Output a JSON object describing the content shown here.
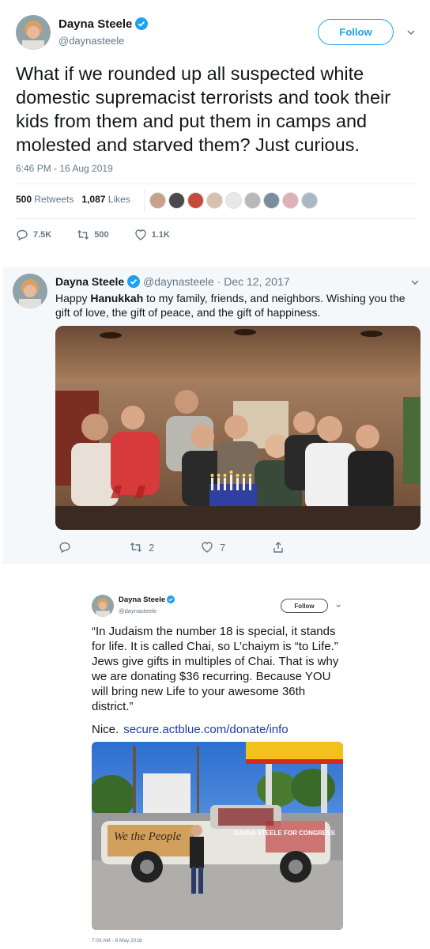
{
  "tweet1": {
    "author_name": "Dayna Steele",
    "handle": "@daynasteele",
    "follow_label": "Follow",
    "text": "What if we rounded up all suspected white domestic supremacist terrorists and took their kids from them and put them in camps and molested and starved them? Just curious.",
    "timestamp": "6:46 PM - 16 Aug 2019",
    "retweets_count": "500",
    "retweets_label": "Retweets",
    "likes_count": "1,087",
    "likes_label": "Likes",
    "liker_colors": [
      "#c9a08c",
      "#4a4a4a",
      "#c84a3a",
      "#d8c0b0",
      "#e8e8e8",
      "#b8b8b8",
      "#7a8ca0",
      "#e0b0b8",
      "#aab8c2"
    ],
    "actions": {
      "reply": "7.5K",
      "retweet": "500",
      "like": "1.1K"
    },
    "accent_color": "#1da1f2"
  },
  "tweet2": {
    "author_name": "Dayna Steele",
    "handle": "@daynasteele",
    "separator": "·",
    "date": "Dec 12, 2017",
    "text_before": "Happy ",
    "text_bold": "Hanukkah",
    "text_after": " to my family, friends, and neighbors. Wishing you the gift of love, the gift of peace, and the gift of happiness.",
    "actions": {
      "retweet": "2",
      "like": "7"
    }
  },
  "tweet3": {
    "author_name": "Dayna Steele",
    "handle": "@daynasteele",
    "follow_label": "Follow",
    "text": "“In Judaism the number 18 is special, it stands for life. It is called Chai, so L’chaiym is “to Life.” Jews give gifts in multiples of Chai. That is why we are donating $36 recurring. Because YOU will bring new Life to your awesome 36th district.”",
    "nice_label": "Nice.",
    "link_text": "secure.actblue.com/donate/info",
    "truck_text": "We the People",
    "sign_text": "DAYNA STEELE FOR CONGRESS",
    "timestamp": "7:03 AM - 8 May 2018"
  }
}
